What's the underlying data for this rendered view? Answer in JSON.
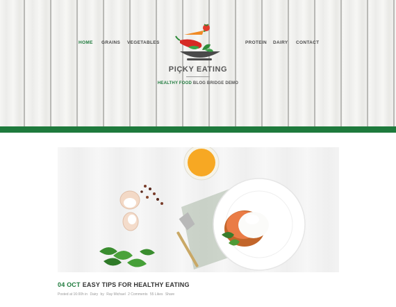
{
  "nav": {
    "left": [
      "HOME",
      "GRAINS",
      "VEGETABLES"
    ],
    "right": [
      "PROTEIN",
      "DAIRY",
      "CONTACT"
    ],
    "active": "HOME"
  },
  "brand": {
    "title": "PIÇKY EATING",
    "tagline_accent": "HEALTHY FOOD",
    "tagline_rest": "BLOG BRIDGE DEMO"
  },
  "post": {
    "date": "04 OCT",
    "title": "EASY TIPS FOR HEALTHY EATING",
    "meta": {
      "posted": "Posted at 16:00h in",
      "category": "Dairy",
      "by": "by",
      "author": "Ray Michael",
      "comments": "2 Comments",
      "likes": "55 Likes",
      "share": "Share"
    }
  },
  "colors": {
    "accent": "#1e7a3c",
    "text": "#555555",
    "nav": "#4a4a4a"
  }
}
